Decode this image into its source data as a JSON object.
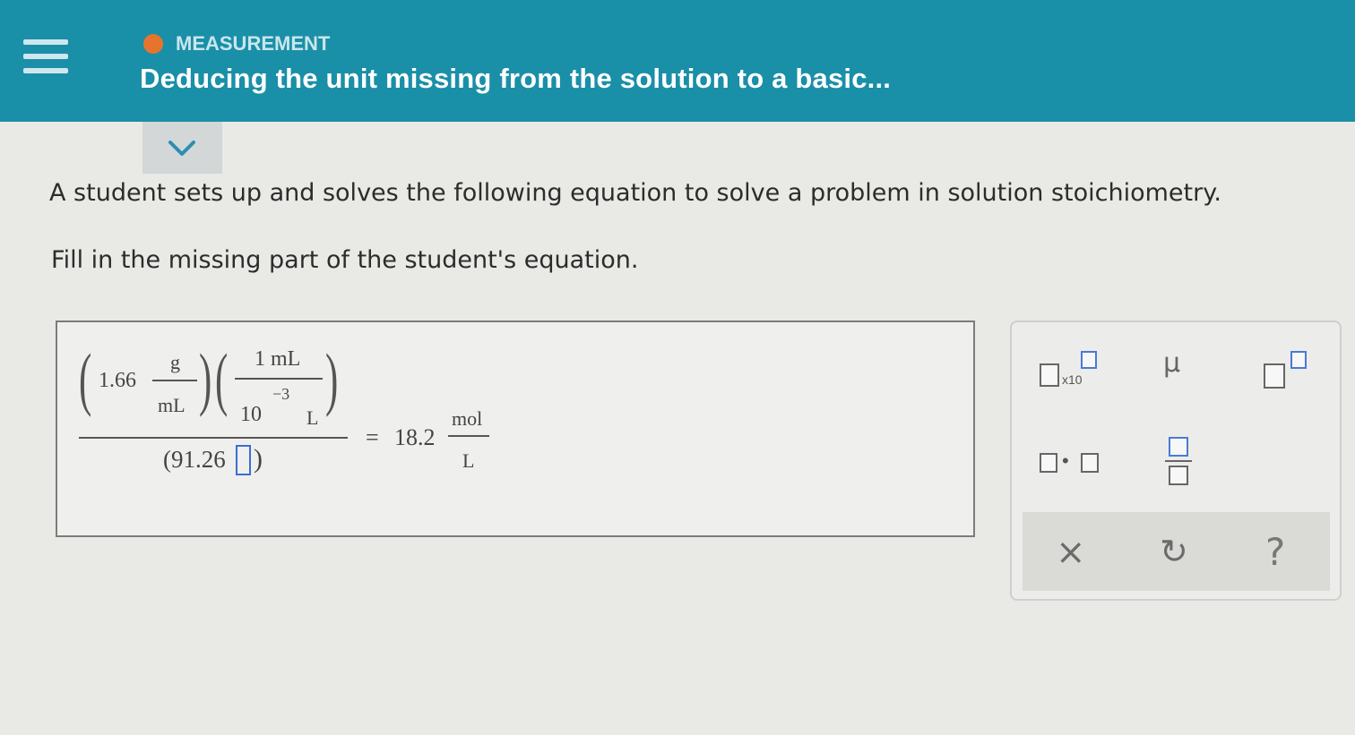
{
  "header": {
    "topic_label": "MEASUREMENT",
    "title": "Deducing the unit missing from the solution to a basic...",
    "accent_color": "#1a8fa8",
    "status_dot_color": "#e7742e"
  },
  "question": {
    "line1": "A student sets up and solves the following equation to solve a problem in solution stoichiometry.",
    "line2": "Fill in the missing part of the student's equation."
  },
  "equation": {
    "first_factor_value": "1.66",
    "first_factor_num": "g",
    "first_factor_den": "mL",
    "second_factor_num": "1 mL",
    "second_factor_den_base": "10",
    "second_factor_den_exp": "−3",
    "second_factor_den_unit": "L",
    "denominator_value": "(91.26",
    "denominator_close": ")",
    "equals": "=",
    "result_value": "18.2",
    "result_num": "mol",
    "result_den": "L"
  },
  "palette": {
    "sci_notation_label": "x10",
    "mu_label": "μ",
    "dot_label": "•",
    "clear_label": "×",
    "undo_label": "↻",
    "help_label": "?"
  },
  "icons": [
    "menu-icon",
    "chevron-down-icon",
    "clear-icon",
    "undo-icon",
    "help-icon"
  ]
}
